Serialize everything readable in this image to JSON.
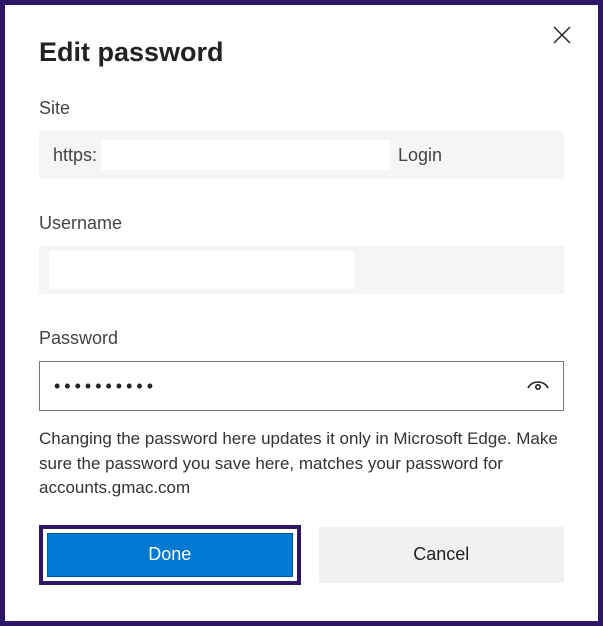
{
  "dialog": {
    "title": "Edit password"
  },
  "fields": {
    "site": {
      "label": "Site",
      "protocol": "https:",
      "suffix": "Login"
    },
    "username": {
      "label": "Username",
      "value": ""
    },
    "password": {
      "label": "Password",
      "masked_value": "••••••••••"
    }
  },
  "helper_text": "Changing the password here updates it only in Microsoft Edge. Make sure the password you save here, matches your password for accounts.gmac.com",
  "buttons": {
    "done": "Done",
    "cancel": "Cancel"
  }
}
